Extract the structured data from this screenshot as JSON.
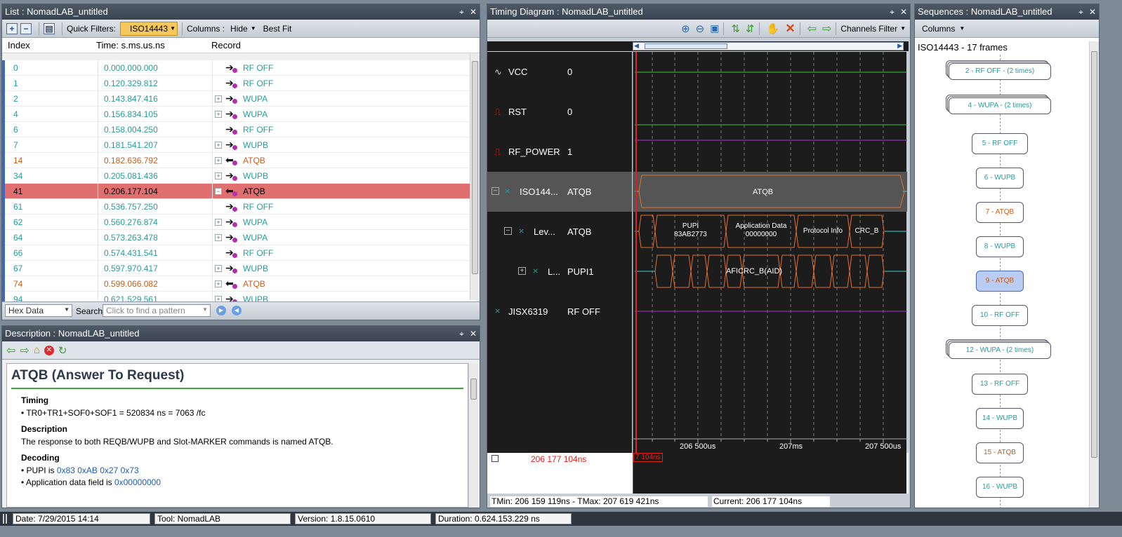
{
  "list_panel": {
    "title": "List : NomadLAB_untitled",
    "quick_filters_label": "Quick Filters:",
    "quick_filter_value": "ISO14443",
    "columns_label": "Columns :",
    "hide_label": "Hide",
    "best_fit_label": "Best Fit",
    "headers": {
      "index": "Index",
      "time": "Time: s.ms.us.ns",
      "record": "Record"
    },
    "rows": [
      {
        "index": "0",
        "time": "0.000.000.000",
        "record": "RF OFF"
      },
      {
        "index": "1",
        "time": "0.120.329.812",
        "record": "RF OFF"
      },
      {
        "index": "2",
        "time": "0.143.847.416",
        "record": "WUPA"
      },
      {
        "index": "4",
        "time": "0.156.834.105",
        "record": "WUPA"
      },
      {
        "index": "6",
        "time": "0.158.004.250",
        "record": "RF OFF"
      },
      {
        "index": "7",
        "time": "0.181.541.207",
        "record": "WUPB"
      },
      {
        "index": "14",
        "time": "0.182.636.792",
        "record": "ATQB"
      },
      {
        "index": "34",
        "time": "0.205.081.436",
        "record": "WUPB"
      },
      {
        "index": "41",
        "time": "0.206.177.104",
        "record": "ATQB"
      },
      {
        "index": "61",
        "time": "0.536.757.250",
        "record": "RF OFF"
      },
      {
        "index": "62",
        "time": "0.560.276.874",
        "record": "WUPA"
      },
      {
        "index": "64",
        "time": "0.573.263.478",
        "record": "WUPA"
      },
      {
        "index": "66",
        "time": "0.574.431.541",
        "record": "RF OFF"
      },
      {
        "index": "67",
        "time": "0.597.970.417",
        "record": "WUPB"
      },
      {
        "index": "74",
        "time": "0.599.066.082",
        "record": "ATQB"
      },
      {
        "index": "94",
        "time": "0.621.529.561",
        "record": "WUPB"
      }
    ],
    "search": {
      "format": "Hex Data",
      "label": "Search",
      "placeholder": "Click to find a pattern"
    }
  },
  "description_panel": {
    "title": "Description : NomadLAB_untitled",
    "heading": "ATQB (Answer To Request)",
    "timing_label": "Timing",
    "timing_value": "TR0+TR1+SOF0+SOF1 = 520834 ns = 7063 /fc",
    "description_label": "Description",
    "description_text": "The response to both REQB/WUPB and Slot-MARKER commands is named ATQB.",
    "decoding_label": "Decoding",
    "pupi_prefix": "PUPI is ",
    "pupi_value": "0x83 0xAB 0x27 0x73",
    "app_prefix": "Application data field is ",
    "app_value": "0x00000000"
  },
  "timing_panel": {
    "title": "Timing Diagram : NomadLAB_untitled",
    "channels_filter": "Channels Filter",
    "channels": [
      {
        "name": "VCC",
        "value": "0"
      },
      {
        "name": "RST",
        "value": "0"
      },
      {
        "name": "RF_POWER",
        "value": "1"
      },
      {
        "name": "ISO144...",
        "value": "ATQB"
      },
      {
        "name": "Lev...",
        "value": "ATQB"
      },
      {
        "name": "L...",
        "value": "PUPI1"
      },
      {
        "name": "JISX6319",
        "value": "RF OFF"
      }
    ],
    "frame_label": "ATQB",
    "fields": {
      "pupi": "PUPI",
      "pupi_val": "83AB2773",
      "app": "Application Data",
      "app_val": "00000000",
      "proto": "Protocol Info",
      "crc": "CRC_B"
    },
    "sub_label": "AFICRC_B(AID)",
    "axis_ticks": [
      "206 500us",
      "207ms",
      "207 500us"
    ],
    "cursor_time": "206 177 104ns",
    "cursor_marker": "7 104ns",
    "tmin_tmax": "TMin: 206 159 119ns - TMax: 207 619 421ns",
    "current": "Current: 206 177 104ns"
  },
  "sequences_panel": {
    "title": "Sequences : NomadLAB_untitled",
    "columns_label": "Columns",
    "summary": "ISO14443 - 17 frames",
    "items": [
      {
        "label": "2 - RF OFF - (2 times)"
      },
      {
        "label": "4 - WUPA - (2 times)"
      },
      {
        "label": "5 - RF OFF"
      },
      {
        "label": "6 - WUPB"
      },
      {
        "label": "7 - ATQB"
      },
      {
        "label": "8 - WUPB"
      },
      {
        "label": "9 - ATQB"
      },
      {
        "label": "10 - RF OFF"
      },
      {
        "label": "12 - WUPA - (2 times)"
      },
      {
        "label": "13 - RF OFF"
      },
      {
        "label": "14 - WUPB"
      },
      {
        "label": "15 - ATQB"
      },
      {
        "label": "16 - WUPB"
      }
    ]
  },
  "status_bar": {
    "date": "Date: 7/29/2015 14:14",
    "tool": "Tool: NomadLAB",
    "version": "Version: 1.8.15.0610",
    "duration": "Duration: 0.624.153.229 ns"
  },
  "colors": {
    "teal": "#2a9a9a",
    "orange": "#c06020",
    "selected_row": "#e07070",
    "waveform": "#e07030"
  }
}
